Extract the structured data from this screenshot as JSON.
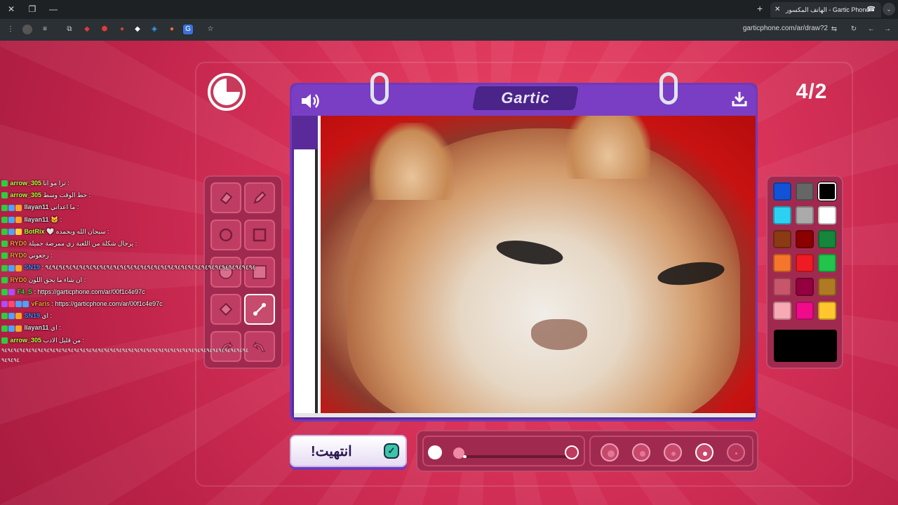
{
  "browser": {
    "tab_title": "الهاتف المكسور - Gartic Phone",
    "url": "garticphone.com/ar/draw?2",
    "extension_icons": [
      "avatar-icon",
      "reader-icon",
      "puzzle-icon",
      "ext-red-icon",
      "ext-shield-icon",
      "ext-red-dot-icon",
      "ext-diamond-icon",
      "ext-mask-icon",
      "ext-blue-icon",
      "ext-translate-icon"
    ]
  },
  "game": {
    "logo": "Gartic",
    "round": "4/2",
    "timer_elapsed_fraction": 0.25,
    "done_label": "!انتهيت",
    "tools": [
      "eraser",
      "pencil",
      "ellipse",
      "rectangle",
      "filled-ellipse",
      "filled-rectangle",
      "fill-bucket",
      "line",
      "undo",
      "redo"
    ],
    "selected_tool": "line",
    "palette": [
      "#1352d6",
      "#666666",
      "#000000",
      "#2cd1f2",
      "#aaaaaa",
      "#ffffff",
      "#8b3a14",
      "#8b0000",
      "#15863b",
      "#f5762b",
      "#ee1b24",
      "#22c44c",
      "#c7566b",
      "#94003f",
      "#b07a24",
      "#f7a9b4",
      "#ef0b8a",
      "#ffc72d"
    ],
    "selected_color": "#000000",
    "current_color": "#000000",
    "brush_size_fraction": 0.03,
    "brush_sizes": [
      "xl",
      "l",
      "m",
      "s",
      "xs"
    ],
    "selected_brush_size": "s"
  },
  "chat": [
    {
      "user": "arrow_305",
      "text": "ترا مو انا :",
      "color": "#c8ff3c",
      "badges": [
        "#2ecc40"
      ]
    },
    {
      "user": "arrow_305",
      "text": "حط الوقت وسط :",
      "color": "#c8ff3c",
      "badges": [
        "#2ecc40"
      ]
    },
    {
      "user": "llayan11",
      "text": "ما اعداني :",
      "color": "#e0e0e0",
      "badges": [
        "#2ecc40",
        "#4aa3ff",
        "#f5a623"
      ]
    },
    {
      "user": "llayan11",
      "text": "🐱 :",
      "color": "#e0e0e0",
      "badges": [
        "#2ecc40",
        "#4aa3ff",
        "#f5a623"
      ]
    },
    {
      "user": "BotRix",
      "text": "🤍 سبحان الله وبحمده :",
      "color": "#c8ff3c",
      "badges": [
        "#2ecc40",
        "#4aa3ff",
        "#ffd23c"
      ]
    },
    {
      "user": "RYD0",
      "text": "يرجال شكلة من اللعبة زي ممرضة جميلة :",
      "color": "#ff9f3c",
      "badges": [
        "#2ecc40"
      ]
    },
    {
      "user": "RYD0",
      "text": "رجعوني :",
      "color": "#ff9f3c",
      "badges": [
        "#2ecc40"
      ]
    },
    {
      "user": "SN19",
      "text": ": ٩٤٩٤٩٤٩٤٩٤٩٤٩٤٩٤٩٤٩٤٩٤٩٤٩٤٩٤٩٤٩٤٩٤٩٤٩٤٩٤٩٤٩٤٩٤٩٤٩٤٩٤٩٤٩٤٩٤٩٤٩٤",
      "color": "#3c8cff",
      "badges": [
        "#2ecc40",
        "#4aa3ff",
        "#f5a623"
      ]
    },
    {
      "user": "RYD0",
      "text": "ان شاء ما يحق اللون :",
      "color": "#ff9f3c",
      "badges": [
        "#2ecc40"
      ]
    },
    {
      "user": "F4_S",
      "text": ": https://garticphone.com/ar/00f1c4e97c",
      "color": "#4ad14a",
      "badges": [
        "#2ecc40",
        "#b34aff"
      ]
    },
    {
      "user": "vFaris",
      "text": ": https://garticphone.com/ar/00f1c4e97c",
      "color": "#ff9f3c",
      "badges": [
        "#b34aff",
        "#ff4a6a",
        "#4aa3ff",
        "#4aa3ff"
      ]
    },
    {
      "user": "SN19",
      "text": "اي :",
      "color": "#3c8cff",
      "badges": [
        "#2ecc40",
        "#4aa3ff",
        "#f5a623"
      ]
    },
    {
      "user": "llayan11",
      "text": "اي :",
      "color": "#e0e0e0",
      "badges": [
        "#2ecc40",
        "#4aa3ff",
        "#f5a623"
      ]
    },
    {
      "user": "arrow_305",
      "text": "من قليل الادب :",
      "color": "#c8ff3c",
      "badges": [
        "#2ecc40"
      ]
    }
  ],
  "chat_overflow": {
    "line1": "٩٤٩٤٩٤٩٤٩٤٩٤٩٤٩٤٩٤٩٤٩٤٩٤٩٤٩٤٩٤٩٤٩٤٩٤٩٤٩٤٩٤٩٤٩٤٩٤٩٤٩٤٩٤٩٤٩٤٩٤٩٤٩٤٩٤٩٤٩٤٩٤٩٤٩٤٩٤٩٤٩٤",
    "line2": "٩٤٩٤٩٤"
  }
}
